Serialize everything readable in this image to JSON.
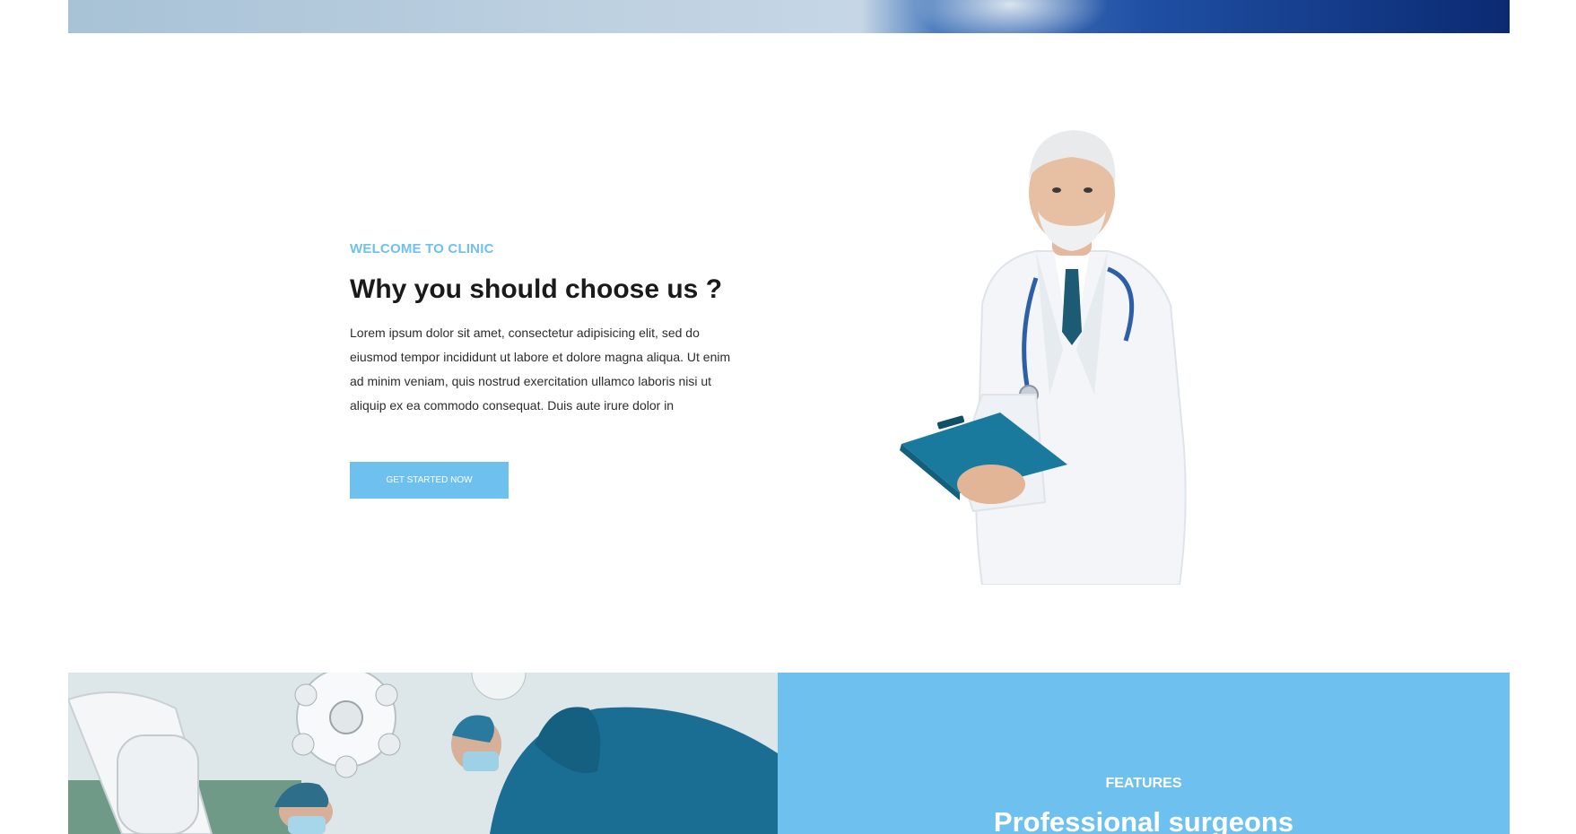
{
  "intro": {
    "eyebrow": "WELCOME TO CLINIC",
    "heading": "Why you should choose us ?",
    "body": "Lorem ipsum dolor sit amet, consectetur adipisicing elit, sed do eiusmod tempor incididunt ut labore et dolore magna aliqua. Ut enim ad minim veniam, quis nostrud exercitation ullamco laboris nisi ut aliquip ex ea commodo consequat. Duis aute irure dolor in",
    "cta_label": "GET STARTED NOW"
  },
  "features": {
    "eyebrow": "FEATURES",
    "title": "Professional surgeons"
  },
  "colors": {
    "accent": "#6ec1ee",
    "heading": "#1a1a1a",
    "body": "#2c2c2c"
  }
}
